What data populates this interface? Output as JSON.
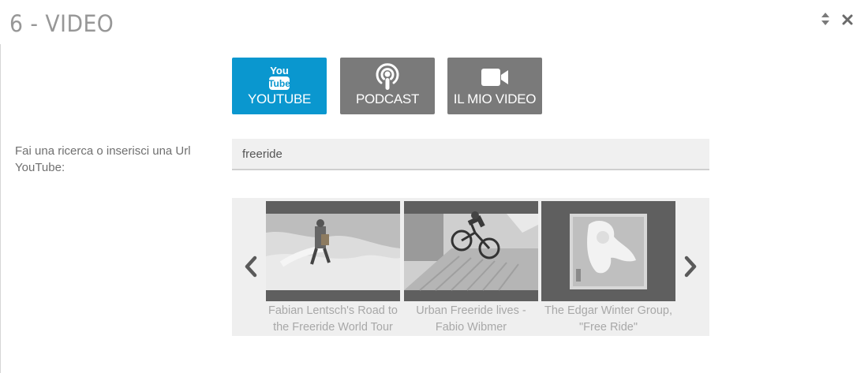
{
  "window": {
    "title": "6 - VIDEO",
    "controls": {
      "sort_icon": "sort-icon",
      "close_icon": "close-icon"
    }
  },
  "sources": [
    {
      "label": "YOUTUBE",
      "icon": "youtube-icon",
      "active": true,
      "logo_top": "You",
      "logo_bottom": "Tube"
    },
    {
      "label": "PODCAST",
      "icon": "podcast-icon",
      "active": false
    },
    {
      "label": "IL MIO VIDEO",
      "icon": "video-camera-icon",
      "active": false
    }
  ],
  "search": {
    "label": "Fai una ricerca o inserisci una Url YouTube:",
    "value": "freeride"
  },
  "results": [
    {
      "title": "Fabian Lentsch's Road to the Freeride World Tour",
      "thumb": "ski-freeride-thumbnail"
    },
    {
      "title": "Urban Freeride lives - Fabio Wibmer",
      "thumb": "urban-bike-thumbnail"
    },
    {
      "title": "The Edgar Winter Group, \"Free Ride\"",
      "thumb": "album-cover-thumbnail"
    }
  ],
  "colors": {
    "active": "#0a97cf",
    "inactive": "#7a7a7a",
    "carousel_bg": "#efefef"
  }
}
